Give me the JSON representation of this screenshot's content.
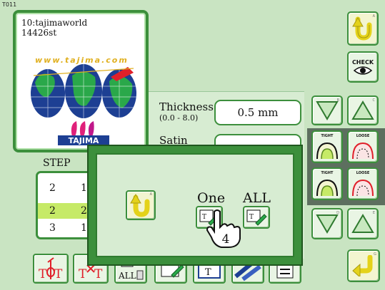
{
  "screen": {
    "id": "T011"
  },
  "design": {
    "name": "10:tajimaworld",
    "stitches": "14426st",
    "logo_url_text": "www.tajima.com",
    "logo_brand_text": "TAJIMA"
  },
  "params": {
    "thickness": {
      "label": "Thickness",
      "range": "(0.0 - 8.0)",
      "value": "0.5 mm"
    },
    "satin": {
      "label": "Satin"
    }
  },
  "right_buttons": {
    "check_label": "CHECK",
    "tight_label": "TIGHT",
    "loose_label": "LOOSE",
    "marks": [
      "A",
      "B",
      "C",
      "D",
      "E",
      "F",
      "G"
    ]
  },
  "step": {
    "title": "STEP",
    "rows": [
      {
        "a": "2",
        "b": "1",
        "selected": false
      },
      {
        "a": "2",
        "b": "2",
        "selected": true
      },
      {
        "a": "3",
        "b": "1",
        "selected": false
      }
    ]
  },
  "bottom": {
    "all_label": "ALL"
  },
  "dialog": {
    "one_label": "One",
    "all_label": "ALL",
    "pointer_number": "4",
    "back_mark": "A"
  },
  "colors": {
    "background": "#c9e4c2",
    "panel": "#d7ecd2",
    "border": "#3c8f3c",
    "selected_row": "#c6ea67",
    "yellow_arrow": "#e4d21a",
    "red_needle": "#e0202a",
    "dark_strip": "#5d6f5f"
  },
  "icons": [
    "undo-arrow-icon",
    "check-eye-icon",
    "triangle-down-icon",
    "triangle-up-icon",
    "tight-arc-icon",
    "loose-arc-icon",
    "needle-up-icon",
    "needle-down-icon",
    "all-delete-icon",
    "edit-pencil-icon",
    "text-icon",
    "stripes-icon",
    "list-icon",
    "enter-arrow-icon",
    "hand-pointer-icon",
    "globe-logo-icon"
  ]
}
